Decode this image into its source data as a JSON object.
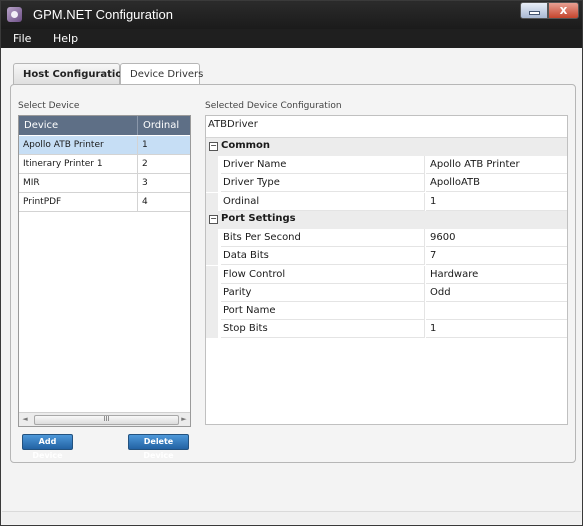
{
  "window": {
    "title": "GPM.NET Configuration",
    "close_glyph": "x"
  },
  "menu": [
    "File",
    "Help"
  ],
  "tabs": [
    {
      "label": "Host Configurations",
      "selected": false
    },
    {
      "label": "Device Drivers",
      "selected": true
    }
  ],
  "select_device": {
    "label": "Select Device",
    "columns": [
      "Device",
      "Ordinal"
    ],
    "rows": [
      {
        "device": "Apollo ATB Printer",
        "ordinal": "1",
        "selected": true
      },
      {
        "device": "Itinerary Printer 1",
        "ordinal": "2",
        "selected": false
      },
      {
        "device": "MIR",
        "ordinal": "3",
        "selected": false
      },
      {
        "device": "PrintPDF",
        "ordinal": "4",
        "selected": false
      }
    ],
    "scroll_left": "◄",
    "scroll_right": "►",
    "scroll_grip": "III",
    "add_button": "Add Device",
    "delete_button": "Delete Device"
  },
  "config": {
    "label": "Selected Device Configuration",
    "driver": "ATBDriver",
    "expander_glyph": "−",
    "categories": [
      {
        "name": "Common",
        "properties": [
          {
            "name": "Driver Name",
            "value": "Apollo ATB Printer"
          },
          {
            "name": "Driver Type",
            "value": "ApolloATB"
          },
          {
            "name": "Ordinal",
            "value": "1"
          }
        ]
      },
      {
        "name": "Port Settings",
        "properties": [
          {
            "name": "Bits Per Second",
            "value": "9600"
          },
          {
            "name": "Data Bits",
            "value": "7"
          },
          {
            "name": "Flow Control",
            "value": "Hardware"
          },
          {
            "name": "Parity",
            "value": "Odd"
          },
          {
            "name": "Port Name",
            "value": ""
          },
          {
            "name": "Stop Bits",
            "value": "1"
          }
        ]
      }
    ]
  },
  "colors": {
    "titlebar": "#1b1b1b",
    "selection": "#c6def5",
    "list_header": "#5e6f86",
    "button_blue": "#2262a3"
  }
}
